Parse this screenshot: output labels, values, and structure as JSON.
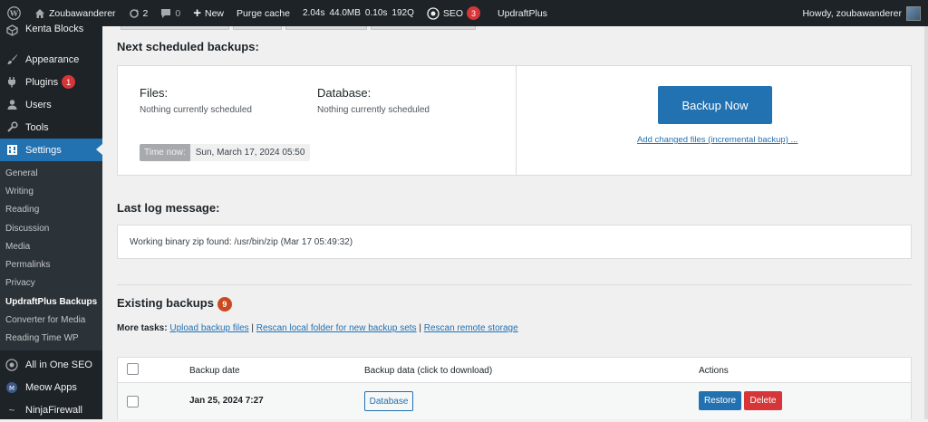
{
  "adminbar": {
    "site_name": "Zoubawanderer",
    "updates_count": "2",
    "comments_count": "0",
    "new_label": "New",
    "purge_label": "Purge cache",
    "perf_time": "2.04s",
    "perf_mem": "44.0MB",
    "perf_query_time": "0.10s",
    "perf_queries": "192Q",
    "seo_label": "SEO",
    "seo_badge": "3",
    "updraft_label": "UpdraftPlus",
    "howdy": "Howdy, zoubawanderer"
  },
  "sidebar": {
    "items": [
      {
        "label": "Kenta Blocks",
        "icon": "blocks-icon"
      },
      {
        "label": "Appearance",
        "icon": "brush-icon"
      },
      {
        "label": "Plugins",
        "icon": "plugin-icon",
        "badge": "1"
      },
      {
        "label": "Users",
        "icon": "user-icon"
      },
      {
        "label": "Tools",
        "icon": "wrench-icon"
      },
      {
        "label": "Settings",
        "icon": "settings-icon"
      }
    ],
    "submenu": [
      "General",
      "Writing",
      "Reading",
      "Discussion",
      "Media",
      "Permalinks",
      "Privacy",
      "UpdraftPlus Backups",
      "Converter for Media",
      "Reading Time WP"
    ],
    "bottom_items": [
      {
        "label": "All in One SEO",
        "icon": "aioseo-icon"
      },
      {
        "label": "Meow Apps",
        "icon": "meow-icon"
      },
      {
        "label": "NinjaFirewall",
        "icon": "firewall-icon"
      }
    ]
  },
  "scheduled": {
    "title": "Next scheduled backups:",
    "files_label": "Files:",
    "files_status": "Nothing currently scheduled",
    "db_label": "Database:",
    "db_status": "Nothing currently scheduled",
    "time_label": "Time now:",
    "time_value": "Sun, March 17, 2024 05:50",
    "backup_button": "Backup Now",
    "incremental_link": "Add changed files (incremental backup) ..."
  },
  "log": {
    "title": "Last log message:",
    "message": "Working binary zip found: /usr/bin/zip (Mar 17 05:49:32)"
  },
  "existing": {
    "title": "Existing backups",
    "count": "9",
    "more_tasks_label": "More tasks:",
    "task_upload": "Upload backup files",
    "sep1": " | ",
    "task_rescan_local": "Rescan local folder for new backup sets",
    "sep2": " | ",
    "task_rescan_remote": "Rescan remote storage"
  },
  "table": {
    "headers": [
      "Backup date",
      "Backup data (click to download)",
      "Actions"
    ],
    "rows": [
      {
        "date": "Jan 25, 2024 7:27",
        "data_button": "Database",
        "restore": "Restore",
        "delete": "Delete"
      }
    ]
  },
  "colors": {
    "accent": "#2271b1",
    "danger": "#d63638",
    "adminbar": "#1d2327"
  }
}
